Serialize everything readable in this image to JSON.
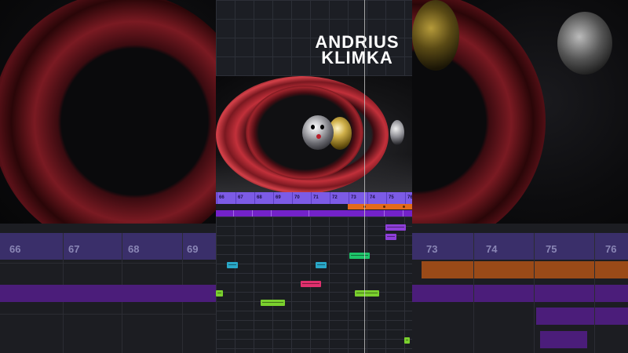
{
  "branding": {
    "line1": "ANDRIUS",
    "line2": "KLIMKA"
  },
  "timeline": {
    "bars": [
      "66",
      "67",
      "68",
      "69",
      "70",
      "71",
      "72",
      "73",
      "74",
      "75",
      "76"
    ],
    "backdrop_left_bars": [
      "66",
      "67",
      "68",
      "69"
    ],
    "backdrop_right_bars": [
      "73",
      "74",
      "75",
      "76"
    ]
  },
  "colors": {
    "ruler": "#7c5be6",
    "orange_clip": "#e36a1b",
    "purple_clip": "#7322c9",
    "note_cyan": "#2aa8c8",
    "note_green": "#1ec46a",
    "note_lime": "#7ad02e",
    "note_pink": "#e0306e",
    "note_violet": "#8e3fd8"
  },
  "notes": [
    {
      "color": "#2aa8c8",
      "bar": 66.5,
      "length": 0.6,
      "lane": 4
    },
    {
      "color": "#2aa8c8",
      "bar": 71.2,
      "length": 0.6,
      "lane": 4
    },
    {
      "color": "#1ec46a",
      "bar": 73.0,
      "length": 1.1,
      "lane": 3
    },
    {
      "color": "#e0306e",
      "bar": 70.4,
      "length": 1.1,
      "lane": 6
    },
    {
      "color": "#7ad02e",
      "bar": 65.5,
      "length": 0.8,
      "lane": 7
    },
    {
      "color": "#7ad02e",
      "bar": 73.3,
      "length": 1.3,
      "lane": 7
    },
    {
      "color": "#7ad02e",
      "bar": 68.3,
      "length": 1.3,
      "lane": 8
    },
    {
      "color": "#7ad02e",
      "bar": 75.9,
      "length": 0.3,
      "lane": 12
    },
    {
      "color": "#8e3fd8",
      "bar": 74.9,
      "length": 1.1,
      "lane": 0
    },
    {
      "color": "#8e3fd8",
      "bar": 74.9,
      "length": 0.6,
      "lane": 1
    }
  ]
}
